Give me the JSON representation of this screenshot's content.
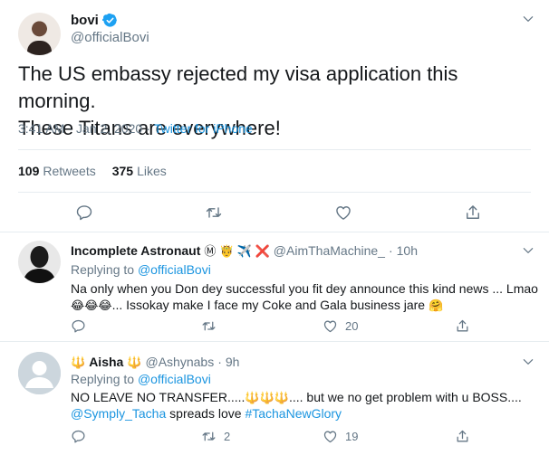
{
  "main_tweet": {
    "author_name": "bovi",
    "handle": "@officialBovi",
    "text_line1": "The US embassy rejected my visa application this morning.",
    "text_line2": "These Titans are everywhere!",
    "time": "3:41 AM",
    "date": "Jan 2, 2020",
    "source": "Twitter for iPhone",
    "retweets_count": "109",
    "retweets_label": "Retweets",
    "likes_count": "375",
    "likes_label": "Likes"
  },
  "replies": [
    {
      "name": "Incomplete Astronaut",
      "emojis": "Ⓜ 🤴 ✈️ ❌",
      "handle": "@AimThaMachine_",
      "time": "10h",
      "replying_prefix": "Replying to ",
      "replying_to": "@officialBovi",
      "line1": "Na only when you Don dey successful you fit dey announce this kind news ... Lmao",
      "line2_emojis": "😂😂😂",
      "line2_text": "... Issokay make I face my Coke and Gala business jare",
      "line2_end_emoji": "🤗",
      "reply_count": "",
      "retweet_count": "",
      "like_count": "20"
    },
    {
      "name": "Aisha",
      "name_emoji_left": "🔱",
      "name_emoji_right": "🔱",
      "handle": "@Ashynabs",
      "time": "9h",
      "replying_prefix": "Replying to ",
      "replying_to": "@officialBovi",
      "line1_start": "NO LEAVE NO TRANSFER.....",
      "line1_emojis": "🔱🔱🔱",
      "line1_end": ".... but we no get problem with u BOSS....",
      "mention": "@Symply_Tacha",
      "line2_mid": " spreads love ",
      "hashtag": "#TachaNewGlory",
      "reply_count": "",
      "retweet_count": "2",
      "like_count": "19"
    }
  ],
  "colors": {
    "link": "#1b95e0",
    "secondary": "#657786",
    "divider": "#e6ecf0",
    "verified": "#1da1f2"
  },
  "icons": [
    "chevron-down-icon",
    "verified-badge-icon",
    "reply-icon",
    "retweet-icon",
    "like-icon",
    "share-icon"
  ]
}
